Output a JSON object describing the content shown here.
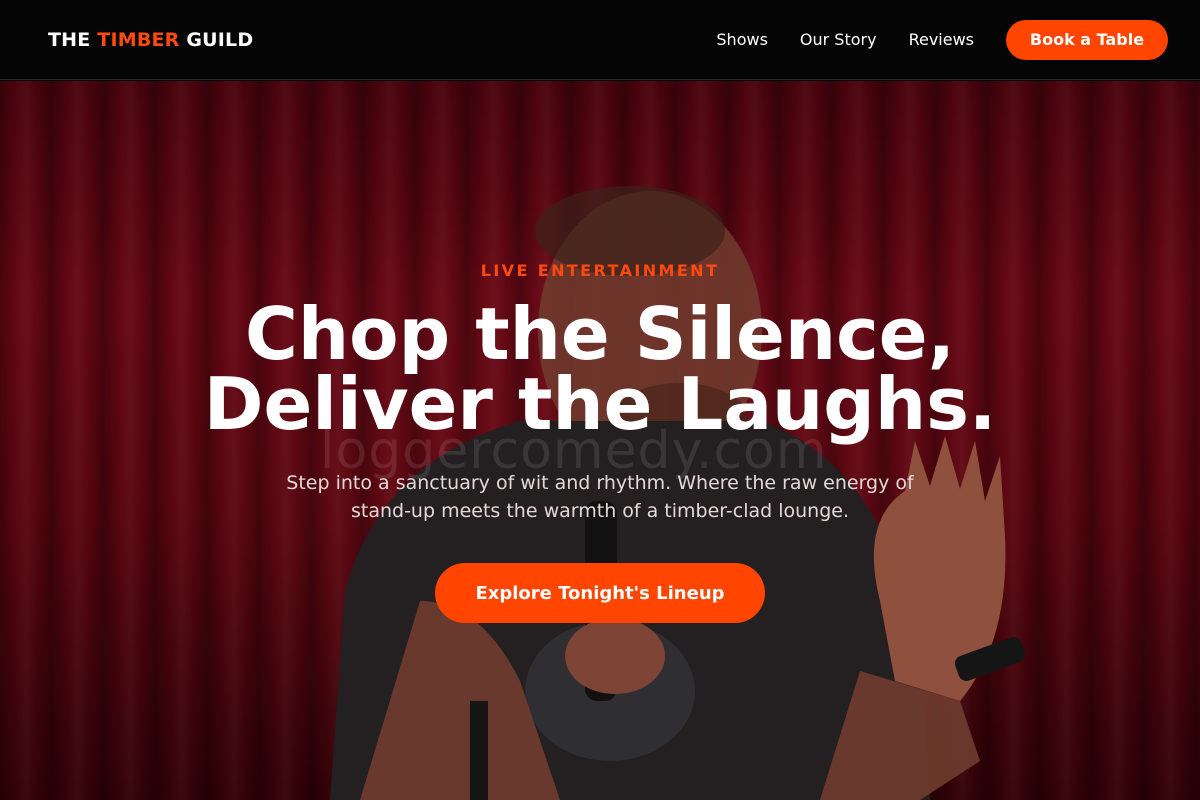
{
  "brand": {
    "part1": "THE",
    "part2": "TIMBER",
    "part3": "GUILD",
    "accent_color": "#ff4a0d"
  },
  "nav": {
    "links": [
      "Shows",
      "Our Story",
      "Reviews"
    ],
    "cta_label": "Book a Table"
  },
  "hero": {
    "eyebrow": "LIVE ENTERTAINMENT",
    "headline_line1": "Chop the Silence,",
    "headline_line2": "Deliver the Laughs.",
    "subtitle_line1": "Step into a sanctuary of wit and rhythm. Where the raw energy of",
    "subtitle_line2": "stand-up meets the warmth of a timber-clad lounge.",
    "cta_label": "Explore Tonight's Lineup",
    "watermark": "loggercomedy.com",
    "background": "red stage curtain with comedian holding microphone",
    "button_color": "#ff4500"
  }
}
